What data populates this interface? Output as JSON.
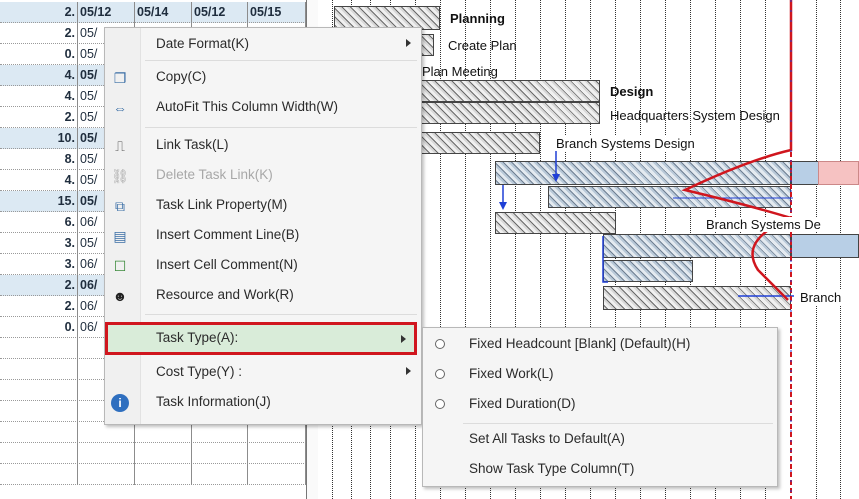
{
  "grid": {
    "rows": [
      {
        "num": "2.",
        "d1": "05/12",
        "d2": "05/14",
        "d3": "05/12",
        "d4": "05/15",
        "type": "summary"
      },
      {
        "num": "2.",
        "d1": "05/",
        "type": "plain"
      },
      {
        "num": "0.",
        "d1": "05/",
        "type": "plain"
      },
      {
        "num": "4.",
        "d1": "05/",
        "type": "summary"
      },
      {
        "num": "4.",
        "d1": "05/",
        "type": "plain"
      },
      {
        "num": "2.",
        "d1": "05/",
        "type": "plain"
      },
      {
        "num": "10.",
        "d1": "05/",
        "type": "summary"
      },
      {
        "num": "8.",
        "d1": "05/",
        "type": "plain"
      },
      {
        "num": "4.",
        "d1": "05/",
        "type": "plain"
      },
      {
        "num": "15.",
        "d1": "05/",
        "type": "summary"
      },
      {
        "num": "6.",
        "d1": "06/",
        "type": "plain"
      },
      {
        "num": "3.",
        "d1": "05/",
        "type": "plain"
      },
      {
        "num": "3.",
        "d1": "06/",
        "type": "plain"
      },
      {
        "num": "2.",
        "d1": "06/",
        "type": "summary"
      },
      {
        "num": "2.",
        "d1": "06/",
        "type": "plain"
      },
      {
        "num": "0.",
        "d1": "06/",
        "type": "plain"
      },
      {
        "num": "",
        "d1": "",
        "type": "plain"
      },
      {
        "num": "",
        "d1": "",
        "type": "plain"
      },
      {
        "num": "",
        "d1": "",
        "type": "plain"
      },
      {
        "num": "",
        "d1": "",
        "type": "plain"
      },
      {
        "num": "",
        "d1": "",
        "type": "plain"
      },
      {
        "num": "",
        "d1": "",
        "type": "plain"
      },
      {
        "num": "",
        "d1": "",
        "type": "plain"
      }
    ]
  },
  "gantt": {
    "labels": {
      "planning": "Planning",
      "create_plan": "Create Plan",
      "plan_meeting": "Plan Meeting",
      "design": "Design",
      "hq_design": "Headquarters System Design",
      "branch_design": "Branch Systems Design",
      "branch_d_cut": "Branch Systems De",
      "branch_cut": "Branch"
    },
    "colors": {
      "today_line": "#d0161e",
      "link_arrow": "#1f3fd6"
    }
  },
  "context_menu": {
    "items": [
      {
        "icon": "none",
        "label": "Date Format(K)",
        "submenu": true,
        "enabled": true
      },
      {
        "icon": "copy-icon",
        "label": "Copy(C)",
        "submenu": false,
        "enabled": true
      },
      {
        "icon": "autofit-icon",
        "label": "AutoFit This Column Width(W)",
        "submenu": false,
        "enabled": true
      },
      {
        "icon": "link-task-icon",
        "label": "Link Task(L)",
        "submenu": false,
        "enabled": true
      },
      {
        "icon": "delete-link-icon",
        "label": "Delete Task Link(K)",
        "submenu": false,
        "enabled": false
      },
      {
        "icon": "link-property-icon",
        "label": "Task Link Property(M)",
        "submenu": false,
        "enabled": true
      },
      {
        "icon": "comment-line-icon",
        "label": "Insert Comment Line(B)",
        "submenu": false,
        "enabled": true
      },
      {
        "icon": "cell-comment-icon",
        "label": "Insert Cell Comment(N)",
        "submenu": false,
        "enabled": true
      },
      {
        "icon": "resource-icon",
        "label": "Resource and Work(R)",
        "submenu": false,
        "enabled": true
      },
      {
        "icon": "none",
        "label": "Task Type(A):",
        "submenu": true,
        "enabled": true,
        "highlighted": true
      },
      {
        "icon": "none",
        "label": "Cost Type(Y) :",
        "submenu": true,
        "enabled": true
      },
      {
        "icon": "info-icon",
        "label": "Task Information(J)",
        "submenu": false,
        "enabled": true
      }
    ]
  },
  "submenu": {
    "items": [
      {
        "radio": true,
        "label": "Fixed Headcount [Blank] (Default)(H)"
      },
      {
        "radio": true,
        "label": "Fixed Work(L)"
      },
      {
        "radio": true,
        "label": "Fixed Duration(D)"
      },
      {
        "radio": false,
        "label": "Set All Tasks to Default(A)"
      },
      {
        "radio": false,
        "label": "Show Task Type Column(T)"
      }
    ]
  }
}
